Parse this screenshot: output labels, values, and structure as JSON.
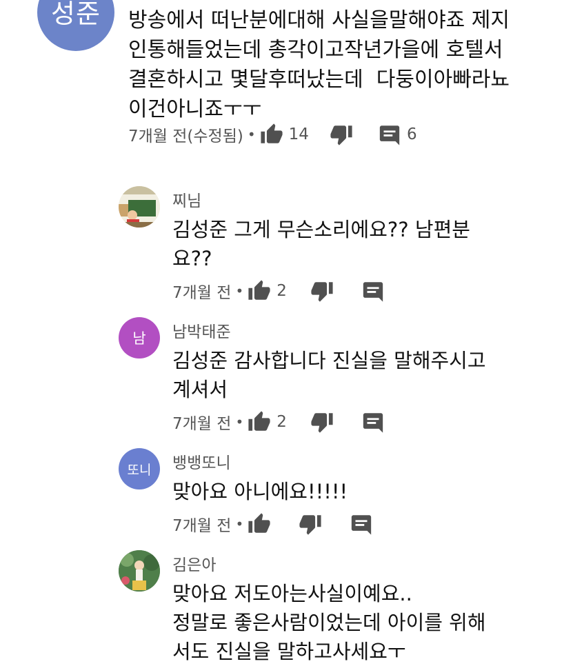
{
  "main_comment": {
    "avatar_text": "성준",
    "avatar_color": "#6c84c9",
    "text": "방송에서 떠난분에대해 사실을말해야죠 제지\n인통해들었는데 총각이고작년가을에 호텔서\n결혼하시고 몇달후떠났는데  다둥이아빠라뇨\n이건아니죠ㅜㅜ",
    "time": "7개월 전(수정됨)",
    "likes": "14",
    "replies": "6"
  },
  "replies": [
    {
      "author": "찌님",
      "avatar_type": "image",
      "text": "김성준 그게 무슨소리에요?? 남편분\n요??",
      "time": "7개월 전",
      "likes": "2"
    },
    {
      "author": "남박태준",
      "avatar_type": "letter",
      "avatar_text": "남",
      "avatar_color": "#b24fc2",
      "text": "김성준 감사합니다 진실을 말해주시고\n계셔서",
      "time": "7개월 전",
      "likes": "2"
    },
    {
      "author": "뱅뱅또니",
      "avatar_type": "letter",
      "avatar_text": "또니",
      "avatar_color": "#6a7fd0",
      "text": "맞아요 아니에요!!!!!",
      "time": "7개월 전",
      "likes": ""
    },
    {
      "author": "김은아",
      "avatar_type": "image",
      "text": "맞아요 저도아는사실이예요..\n정말로 좋은사람이었는데 아이를 위해\n서도 진실을 말하고사세요ㅜ",
      "time": "",
      "likes": ""
    }
  ],
  "icons": {
    "like": "thumbs-up-icon",
    "dislike": "thumbs-down-icon",
    "reply": "comment-icon"
  }
}
